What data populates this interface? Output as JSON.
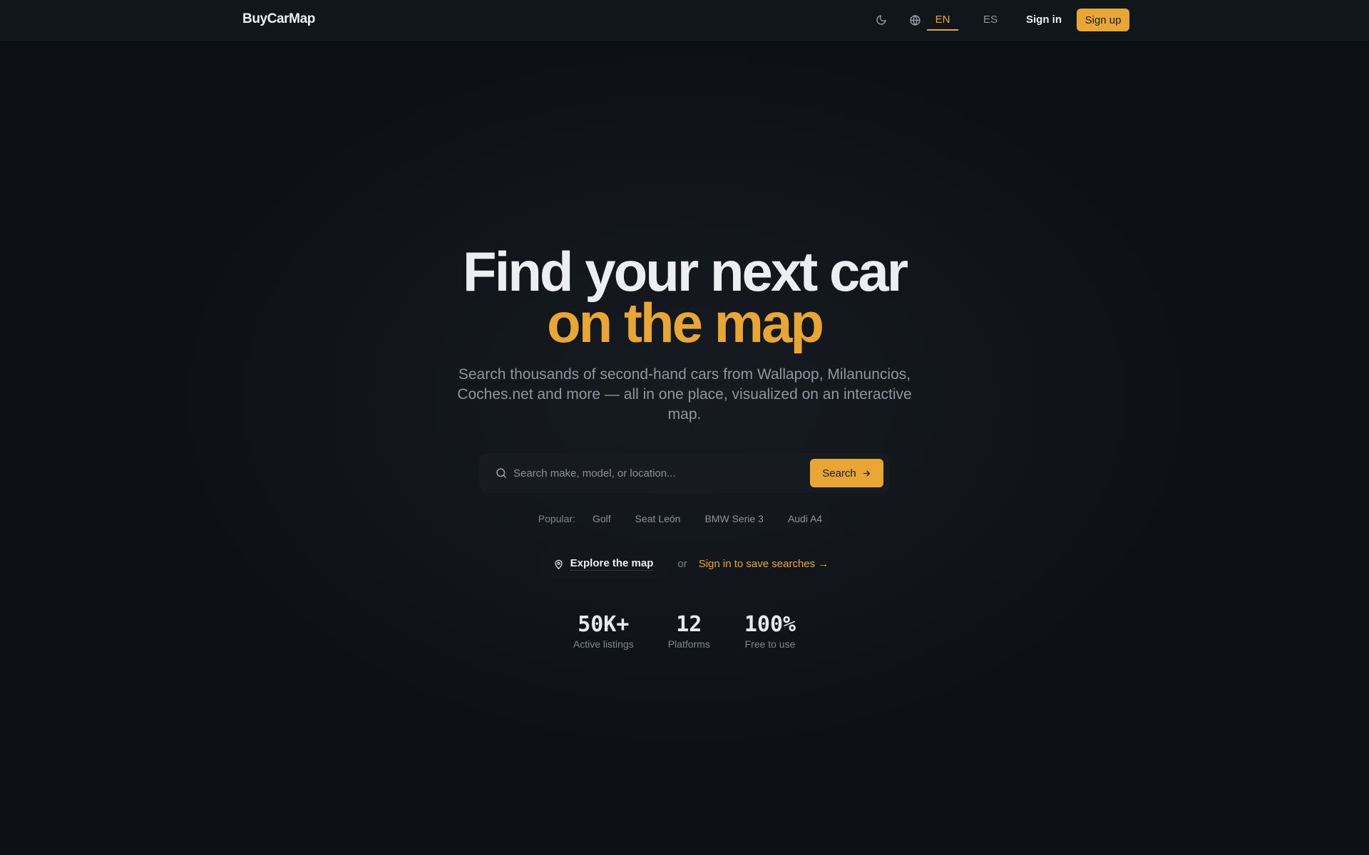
{
  "header": {
    "logo": "BuyCarMap",
    "theme_icon": "moon-icon",
    "language_icon": "globe-icon",
    "languages": [
      {
        "label": "EN",
        "active": true
      },
      {
        "label": "ES",
        "active": false
      }
    ],
    "signin_label": "Sign in",
    "signup_label": "Sign up"
  },
  "hero": {
    "title_line1": "Find your next car",
    "title_line2": "on the map",
    "subtitle": "Search thousands of second-hand cars from Wallapop, Milanuncios, Coches.net and more — all in one place, visualized on an interactive map."
  },
  "search": {
    "placeholder": "Search make, model, or location...",
    "button_label": "Search",
    "icon": "search-icon",
    "button_icon": "arrow-right-icon"
  },
  "popular": {
    "label": "Popular:",
    "items": [
      "Golf",
      "Seat León",
      "BMW Serie 3",
      "Audi A4"
    ]
  },
  "cta": {
    "explore_label": "Explore the map",
    "explore_icon": "map-pin-icon",
    "or_text": "or",
    "save_label": "Sign in to save searches →"
  },
  "stats": [
    {
      "value": "50K+",
      "label": "Active listings"
    },
    {
      "value": "12",
      "label": "Platforms"
    },
    {
      "value": "100%",
      "label": "Free to use"
    }
  ],
  "colors": {
    "accent": "#e8a635",
    "background": "#0d1115",
    "header_background": "#11161a",
    "text_primary": "#eceef1",
    "text_muted": "#8e96a1"
  }
}
